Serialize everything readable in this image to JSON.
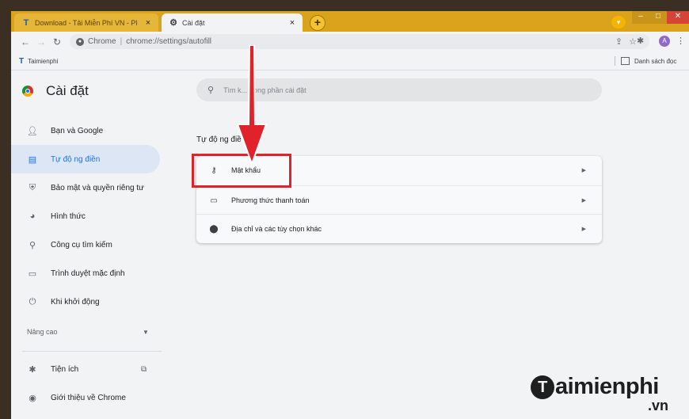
{
  "tabs": [
    {
      "title": "Download - Tải Miễn Phí VN - Pl",
      "favicon": "taimienphi-favicon",
      "close": "×"
    },
    {
      "title": "Cài đặt",
      "favicon": "gear-icon",
      "close": "×"
    }
  ],
  "new_tab_label": "+",
  "toolbar": {
    "chip": "Chrome",
    "separator": "|",
    "url": "chrome://settings/autofill"
  },
  "bookmarks": {
    "left": {
      "icon": "T",
      "label": "Taimienphi"
    },
    "right": {
      "label": "Danh sách đọc"
    }
  },
  "settings": {
    "title": "Cài đặt",
    "search_placeholder": "Tìm k... trong phần cài đặt",
    "nav": [
      {
        "label": "Bạn và Google",
        "icon": "person-icon"
      },
      {
        "label": "Tự độ ng điền",
        "icon": "autofill-icon",
        "active": true
      },
      {
        "label": "Bảo mật và quyền riêng tư",
        "icon": "shield-icon"
      },
      {
        "label": "Hình thức",
        "icon": "palette-icon"
      },
      {
        "label": "Công cụ tìm kiếm",
        "icon": "search-icon"
      },
      {
        "label": "Trình duyệt mặc định",
        "icon": "browser-icon"
      },
      {
        "label": "Khi khởi động",
        "icon": "power-icon"
      }
    ],
    "advanced": "Nâng cao",
    "nav_bottom": [
      {
        "label": "Tiện ích",
        "icon": "puzzle-icon"
      },
      {
        "label": "Giới thiệu về Chrome",
        "icon": "chrome-icon"
      }
    ],
    "section_title": "Tự độ ng điề",
    "autofill_rows": [
      {
        "label": "Mật khẩu",
        "icon": "key-icon"
      },
      {
        "label": "Phương thức thanh toán",
        "icon": "credit-card-icon"
      },
      {
        "label": "Địa chỉ và các tùy chọn khác",
        "icon": "location-pin-icon"
      }
    ]
  },
  "watermark": {
    "main": "aimienphi",
    "t": "T",
    "suffix": ".vn"
  },
  "colors": {
    "accent": "#1a73e8",
    "highlight": "#e0232a",
    "tabstrip": "#d9a31c"
  }
}
